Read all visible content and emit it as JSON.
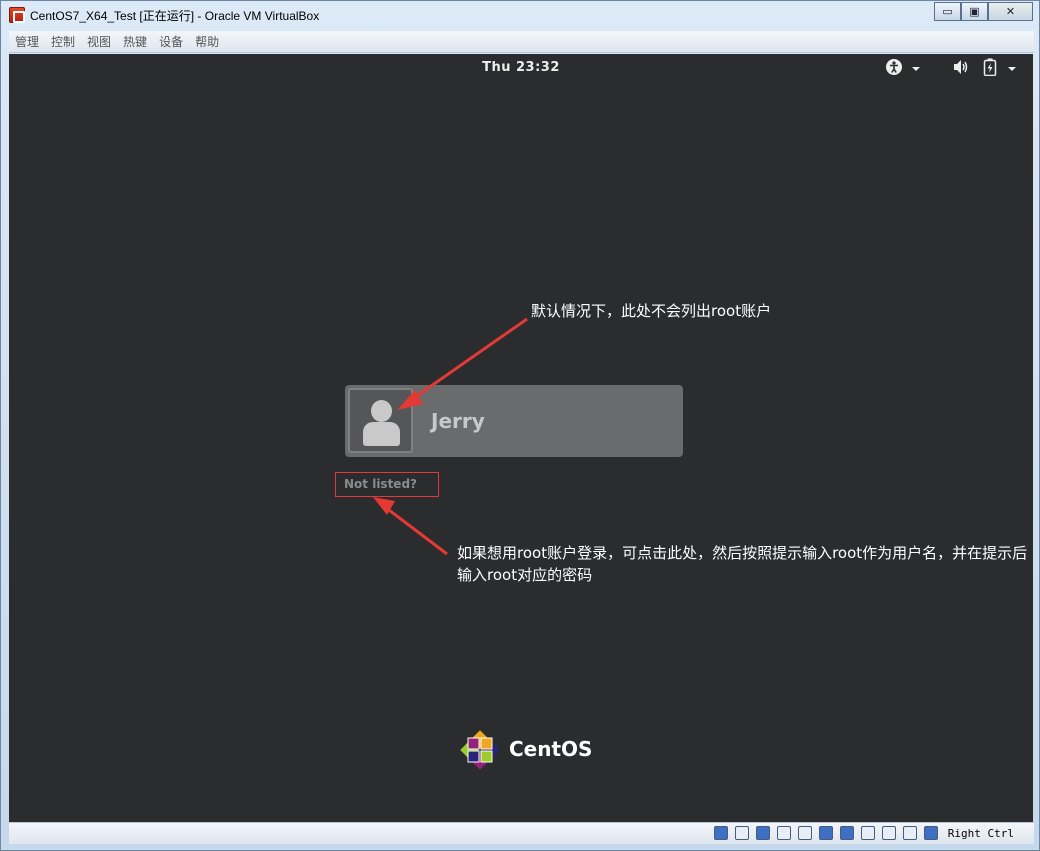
{
  "window": {
    "title": "CentOS7_X64_Test [正在运行] - Oracle VM VirtualBox",
    "minimize": "▭",
    "maximize": "▣",
    "close": "✕"
  },
  "menu": [
    "管理",
    "控制",
    "视图",
    "热键",
    "设备",
    "帮助"
  ],
  "vm": {
    "clock": "Thu 23:32",
    "topbar_icons": [
      "accessibility-icon",
      "dropdown-arrow-icon",
      "volume-icon",
      "battery-icon",
      "dropdown-arrow-icon"
    ],
    "user": {
      "name": "Jerry"
    },
    "not_listed": "Not listed?",
    "annotation_1": "默认情况下，此处不会列出root账户",
    "annotation_2": "如果想用root账户登录，可点击此处，然后按照提示输入root作为用户名，并在提示后输入root对应的密码",
    "logo_text": "CentOS",
    "colors": {
      "background": "#2a2c2e",
      "card": "#6a6b6c",
      "annotation": "#ffffff",
      "highlight": "#e03a3a"
    }
  },
  "statusbar": {
    "host_key": "Right Ctrl"
  }
}
